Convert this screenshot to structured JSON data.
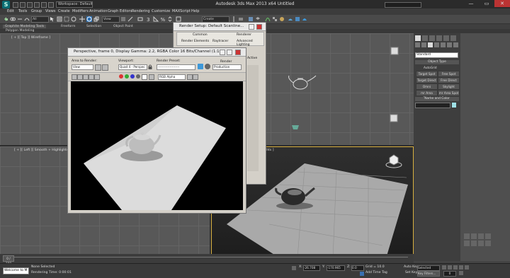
{
  "app": {
    "logo_letter": "S",
    "title": "Autodesk 3ds Max  2013 x64    Untitled",
    "workspace": "Workspace: Default",
    "window_buttons": [
      "—",
      "▭",
      "✕"
    ]
  },
  "menus": [
    "Edit",
    "Tools",
    "Group",
    "Views",
    "Create",
    "Modifiers",
    "Animation",
    "Graph Editors",
    "Rendering",
    "Customize",
    "MAXScript",
    "Help"
  ],
  "toolbar": {
    "filter_select": "All",
    "view_select": "View",
    "named_selection": "Create Selection Se"
  },
  "ribbon": {
    "tabs": [
      "Graphite Modeling Tools",
      "Freeform",
      "Selection",
      "Object Paint"
    ],
    "sub": "Polygon Modeling"
  },
  "viewports": {
    "top_label": "[ + ][ Top ][ Wireframe ]",
    "left_label": "[ + ][ Left ][ Smooth + Highlights ]",
    "persp_fragment": "ights ]"
  },
  "render_setup": {
    "title": "Render Setup: Default Scanline...",
    "tabs_row1": [
      "Common",
      "Renderer"
    ],
    "tabs_row2": [
      "Render Elements",
      "Raytracer",
      "Advanced Lighting"
    ],
    "active_fragment": "Active"
  },
  "frame_window": {
    "title": "Perspective, frame 0, Display Gamma: 2.2, RGBA Color 16 Bits/Channel (1:1)",
    "area_label": "Area to Render:",
    "area_value": "View",
    "viewport_label": "Viewport:",
    "viewport_value": "Quad 4 - Perspec",
    "preset_label": "Render Preset:",
    "preset_value": "--------------------",
    "render_label": "Render",
    "render_value": "Production",
    "channel_value": "RGB Alpha"
  },
  "command_panel": {
    "category": "Standard",
    "object_type_header": "Object Type",
    "autogrid": "AutoGrid",
    "buttons": [
      "Target Spot",
      "Free Spot",
      "Target Direct",
      "Free Direct",
      "Omni",
      "Skylight",
      "mr Area Omni",
      "mr Area Spot"
    ],
    "name_color_header": "Name and Color"
  },
  "status": {
    "frame_counter": "0 / 100",
    "script_listener": "Welcome to M",
    "selection": "None Selected",
    "prompt": "Rendering Time: 0:00:01",
    "coord_x": "-26.708",
    "coord_y": "-170.965",
    "coord_z": "0.0",
    "grid": "Grid = 10.0",
    "autokey": "Auto Key",
    "set_key": "Set Key",
    "selected_dropdown": "Selected",
    "key_filters": "Key Filters...",
    "add_time_tag": "Add Time Tag",
    "time_field": "0"
  }
}
